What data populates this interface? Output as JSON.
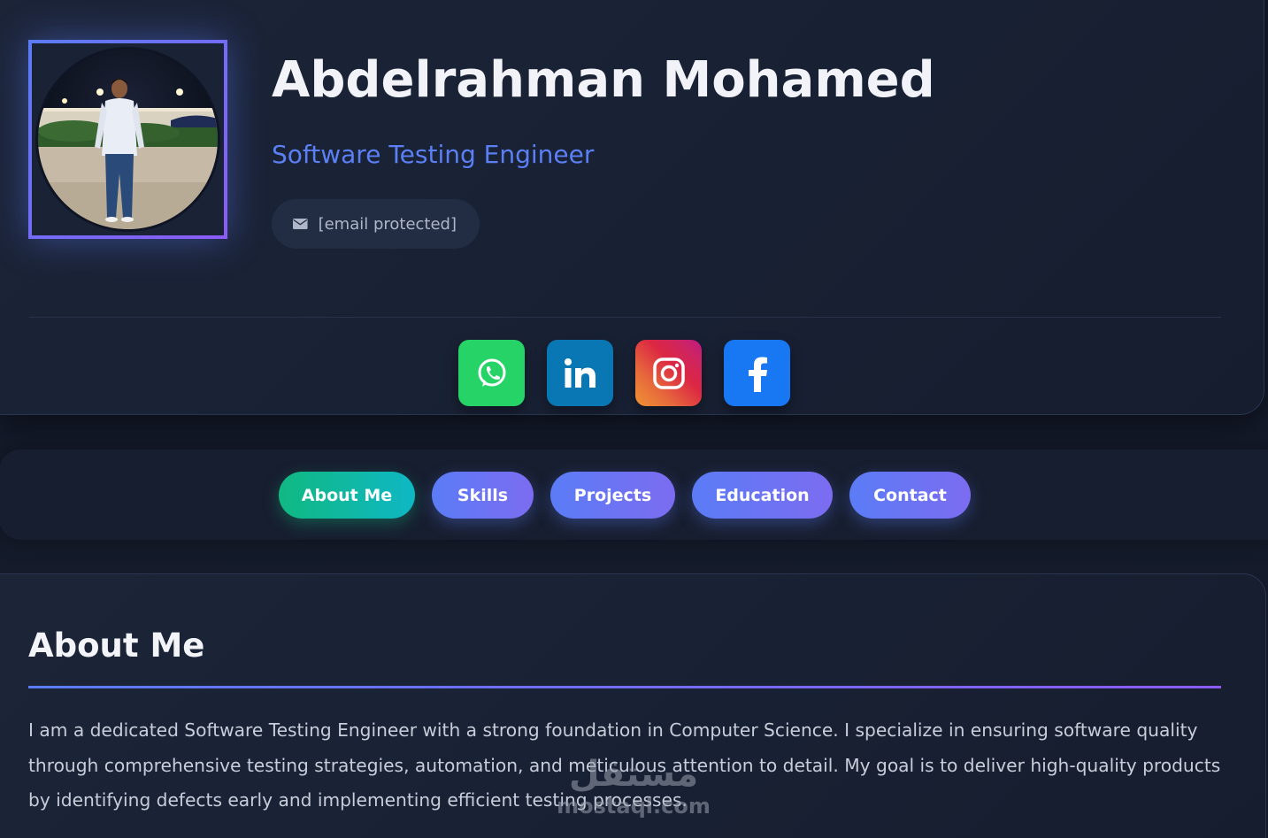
{
  "profile": {
    "name": "Abdelrahman Mohamed",
    "role": "Software Testing Engineer",
    "email": "[email protected]"
  },
  "socials": [
    {
      "name": "WhatsApp",
      "icon": "whatsapp-icon",
      "color": "#25d366"
    },
    {
      "name": "LinkedIn",
      "icon": "linkedin-icon",
      "color": "#0a77b5"
    },
    {
      "name": "Instagram",
      "icon": "instagram-icon",
      "color": "#e1306c"
    },
    {
      "name": "Facebook",
      "icon": "facebook-icon",
      "color": "#1877f2"
    }
  ],
  "nav": {
    "items": [
      {
        "label": "About Me",
        "active": true
      },
      {
        "label": "Skills",
        "active": false
      },
      {
        "label": "Projects",
        "active": false
      },
      {
        "label": "Education",
        "active": false
      },
      {
        "label": "Contact",
        "active": false
      }
    ]
  },
  "about": {
    "title": "About Me",
    "text": "I am a dedicated Software Testing Engineer with a strong foundation in Computer Science. I specialize in ensuring software quality through comprehensive testing strategies, automation, and meticulous attention to detail. My goal is to deliver high-quality products by identifying defects early and implementing efficient testing processes."
  },
  "watermark": {
    "arabic": "مستقل",
    "latin": "mostaql.com"
  },
  "colors": {
    "accent": "#5b7cf6",
    "accent_secondary": "#8b5cf6",
    "active": "#10b981",
    "background": "#141b2b"
  }
}
